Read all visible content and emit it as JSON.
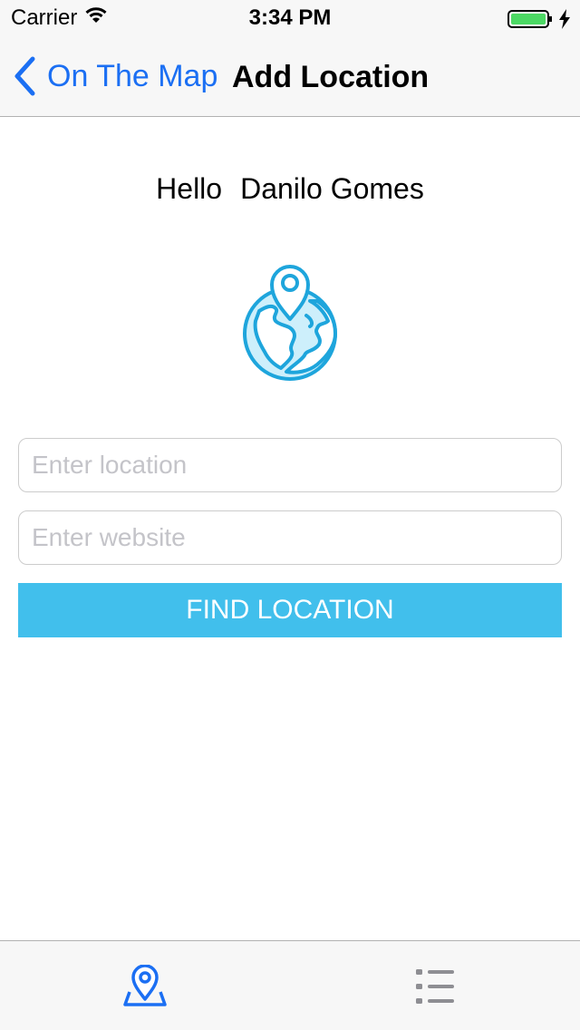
{
  "status_bar": {
    "carrier": "Carrier",
    "time": "3:34 PM",
    "battery_color": "#4cd964"
  },
  "nav": {
    "back_label": "On The Map",
    "title": "Add Location",
    "back_icon": "chevron-left-icon",
    "tint_color": "#1b6ff3"
  },
  "content": {
    "greeting_word": "Hello",
    "user_name": "Danilo Gomes",
    "globe_icon": "globe-pin-icon",
    "location_placeholder": "Enter location",
    "website_placeholder": "Enter website",
    "location_value": "",
    "website_value": "",
    "find_button_label": "FIND LOCATION",
    "button_color": "#41bfec"
  },
  "tab_bar": {
    "tabs": [
      {
        "icon": "map-pin-icon",
        "selected": true
      },
      {
        "icon": "list-icon",
        "selected": false
      }
    ]
  }
}
